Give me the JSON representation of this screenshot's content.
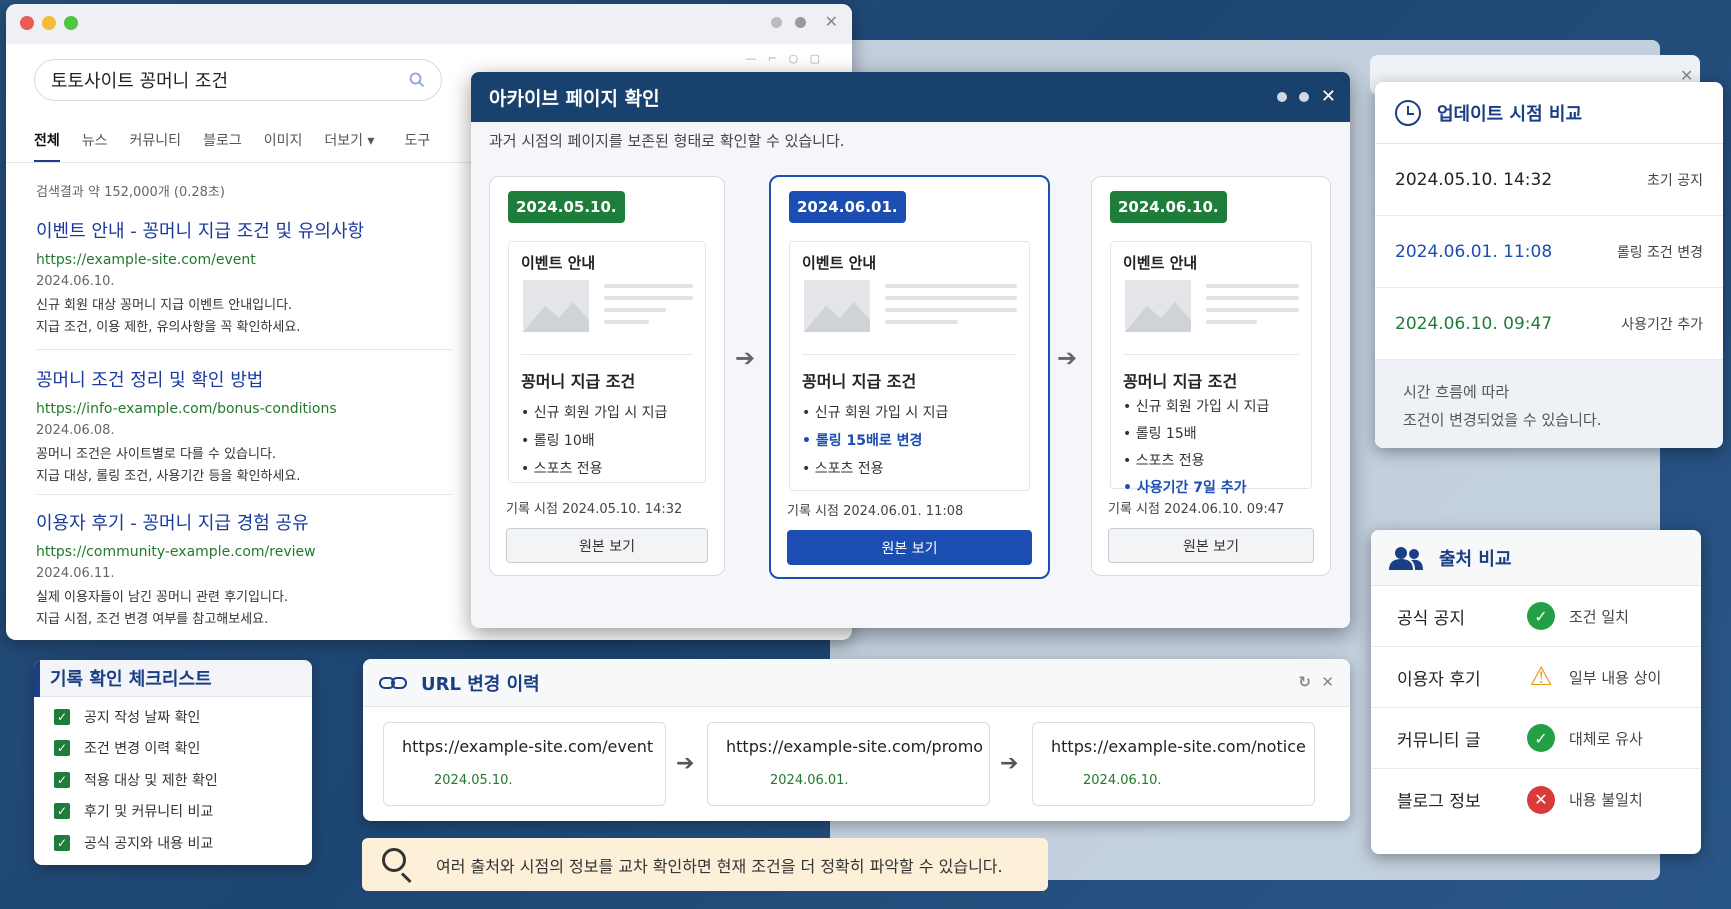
{
  "search_window": {
    "query": "토토사이트 꽁머니 조건",
    "tabs": [
      "전체",
      "뉴스",
      "커뮤니티",
      "블로그",
      "이미지",
      "더보기 ▾",
      "도구"
    ],
    "result_count": "검색결과 약 152,000개 (0.28초)",
    "results": [
      {
        "title": "이벤트 안내 - 꽁머니 지급 조건 및 유의사항",
        "url": "https://example-site.com/event",
        "date": "2024.06.10.",
        "desc1": "신규 회원 대상 꽁머니 지급 이벤트 안내입니다.",
        "desc2": "지급 조건, 이용 제한, 유의사항을 꼭 확인하세요."
      },
      {
        "title": "꽁머니 조건 정리 및 확인 방법",
        "url": "https://info-example.com/bonus-conditions",
        "date": "2024.06.08.",
        "desc1": "꽁머니 조건은 사이트별로 다를 수 있습니다.",
        "desc2": "지급 대상, 롤링 조건, 사용기간 등을 확인하세요."
      },
      {
        "title": "이용자 후기 - 꽁머니 지급 경험 공유",
        "url": "https://community-example.com/review",
        "date": "2024.06.11.",
        "desc1": "실제 이용자들이 남긴 꽁머니 관련 후기입니다.",
        "desc2": "지급 시점, 조건 변경 여부를 참고해보세요."
      }
    ]
  },
  "archive": {
    "title": "아카이브 페이지 확인",
    "subtitle": "과거 시점의 페이지를 보존된 형태로 확인할 수 있습니다.",
    "snapshots": [
      {
        "date_badge": "2024.05.10.",
        "page_title": "이벤트 안내",
        "section": "꽁머니 지급 조건",
        "bullets": [
          "• 신규 회원 가입 시 지급",
          "• 롤링 10배",
          "• 스포츠 전용"
        ],
        "record": "기록 시점 2024.05.10. 14:32",
        "button": "원본 보기"
      },
      {
        "date_badge": "2024.06.01.",
        "page_title": "이벤트 안내",
        "section": "꽁머니 지급 조건",
        "bullets": [
          "• 신규 회원 가입 시 지급",
          "• 롤링 15배로 변경",
          "• 스포츠 전용"
        ],
        "record": "기록 시점 2024.06.01. 11:08",
        "button": "원본 보기"
      },
      {
        "date_badge": "2024.06.10.",
        "page_title": "이벤트 안내",
        "section": "꽁머니 지급 조건",
        "bullets": [
          "• 신규 회원 가입 시 지급",
          "• 롤링 15배",
          "• 스포츠 전용",
          "• 사용기간 7일 추가"
        ],
        "record": "기록 시점 2024.06.10. 09:47",
        "button": "원본 보기"
      }
    ]
  },
  "update_compare": {
    "title": "업데이트 시점 비교",
    "rows": [
      {
        "time": "2024.05.10. 14:32",
        "note": "초기 공지",
        "color": "#222222"
      },
      {
        "time": "2024.06.01. 11:08",
        "note": "롤링 조건 변경",
        "color": "#1b4db2"
      },
      {
        "time": "2024.06.10. 09:47",
        "note": "사용기간 추가",
        "color": "#1f7d3b"
      }
    ],
    "footer1": "시간 흐름에 따라",
    "footer2": "조건이 변경되었을 수 있습니다."
  },
  "source_compare": {
    "title": "출처 비교",
    "rows": [
      {
        "label": "공식 공지",
        "status": "조건 일치",
        "icon": "check-icon"
      },
      {
        "label": "이용자 후기",
        "status": "일부 내용 상이",
        "icon": "warning-icon"
      },
      {
        "label": "커뮤니티 글",
        "status": "대체로 유사",
        "icon": "check-icon"
      },
      {
        "label": "블로그 정보",
        "status": "내용 불일치",
        "icon": "error-icon"
      }
    ]
  },
  "checklist": {
    "title": "기록 확인 체크리스트",
    "items": [
      "공지 작성 날짜 확인",
      "조건 변경 이력 확인",
      "적용 대상 및 제한 확인",
      "후기 및 커뮤니티 비교",
      "공식 공지와 내용 비교"
    ]
  },
  "url_history": {
    "title": "URL 변경 이력",
    "entries": [
      {
        "url": "https://example-site.com/event",
        "date": "2024.05.10."
      },
      {
        "url": "https://example-site.com/promo",
        "date": "2024.06.01."
      },
      {
        "url": "https://example-site.com/notice",
        "date": "2024.06.10."
      }
    ]
  },
  "tip": "여러 출처와 시점의 정보를 교차 확인하면 현재 조건을 더 정확히 파악할 수 있습니다."
}
